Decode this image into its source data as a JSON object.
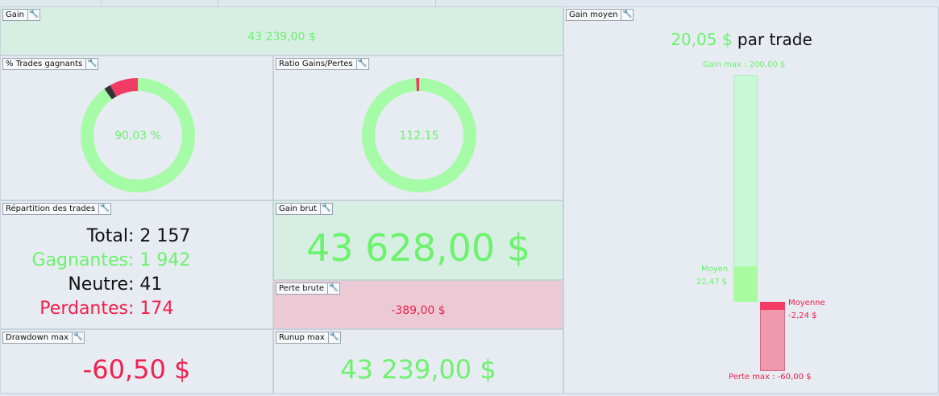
{
  "colors": {
    "green": "#6cf26d",
    "red": "#f0214f",
    "green_bg": "#d7eee3",
    "red_bg": "#ebcad6"
  },
  "gain": {
    "label": "Gain",
    "value": "43 239,00 $"
  },
  "pct_winners": {
    "label": "% Trades gagnants",
    "value": "90,03 %",
    "win_fraction": 0.9003,
    "neutral_fraction": 0.019,
    "loss_fraction": 0.0807
  },
  "ratio": {
    "label": "Ratio Gains/Pertes",
    "value": "112,15",
    "gain_fraction": 0.991,
    "loss_fraction": 0.009
  },
  "repartition": {
    "label": "Répartition des trades",
    "rows": [
      {
        "label": "Total",
        "value": "2 157"
      },
      {
        "label": "Gagnantes",
        "value": "1 942"
      },
      {
        "label": "Neutre",
        "value": "41"
      },
      {
        "label": "Perdantes",
        "value": "174"
      }
    ]
  },
  "gross_gain": {
    "label": "Gain brut",
    "value": "43 628,00 $"
  },
  "gross_loss": {
    "label": "Perte brute",
    "value": "-389,00 $"
  },
  "drawdown": {
    "label": "Drawdown max",
    "value": "-60,50 $"
  },
  "runup": {
    "label": "Runup max",
    "value": "43 239,00 $"
  },
  "avg_gain": {
    "label": "Gain moyen",
    "value": "20,05 $",
    "suffix": "par trade",
    "max_gain_label": "Gain max : 200,00 $",
    "avg_win_label": "Moyen",
    "avg_win_value": "22,47 $",
    "avg_loss_label": "Moyenne",
    "avg_loss_value": "-2,24 $",
    "max_loss_label": "Perte max : -60,00 $",
    "max_gain": 200,
    "avg_win": 22.47,
    "avg_loss": -2.24,
    "max_loss": -60
  },
  "wrench_symbol": "🔧"
}
